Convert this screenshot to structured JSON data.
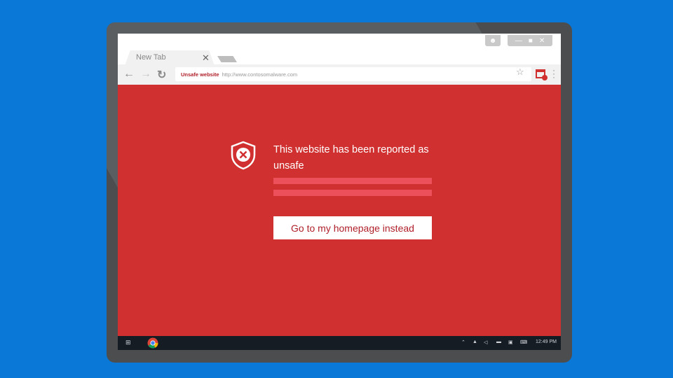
{
  "browser": {
    "tab_label": "New Tab",
    "address_label": "Unsafe website",
    "url": "http://www.contosomalware.com"
  },
  "page": {
    "message": "This website has been reported as unsafe",
    "button_label": "Go to my homepage instead"
  },
  "taskbar": {
    "time": "12:49 PM"
  },
  "colors": {
    "background": "#0a78d7",
    "warning_red": "#d0302f",
    "accent_text": "#b0202a"
  }
}
